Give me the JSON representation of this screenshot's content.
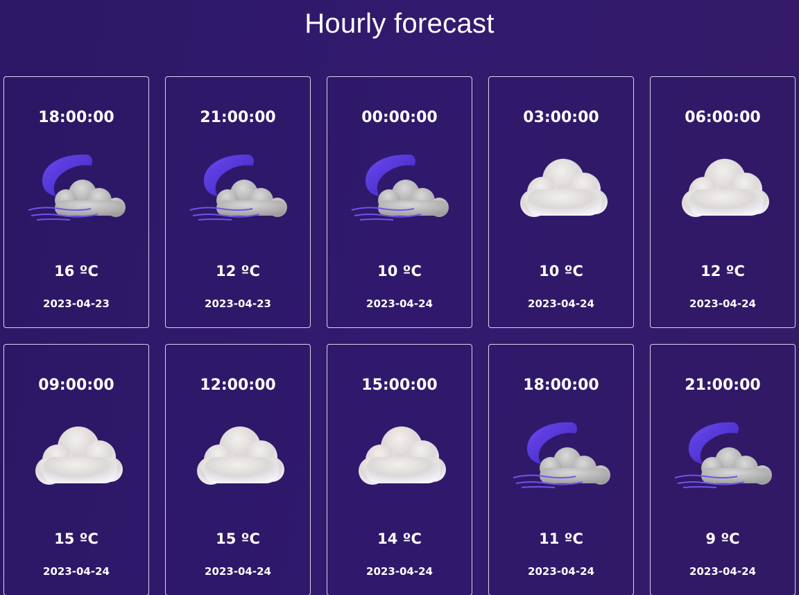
{
  "page": {
    "title": "Hourly forecast"
  },
  "colors": {
    "background": "#2f1a6c",
    "card_border": "#d9d4ec",
    "moon": "#5b3be0",
    "cloud": "#ececf2"
  },
  "forecasts": [
    {
      "time": "18:00:00",
      "temp": "16 ºC",
      "date": "2023-04-23",
      "icon": "night-cloud-wind-icon"
    },
    {
      "time": "21:00:00",
      "temp": "12 ºC",
      "date": "2023-04-23",
      "icon": "night-cloud-wind-icon"
    },
    {
      "time": "00:00:00",
      "temp": "10 ºC",
      "date": "2023-04-24",
      "icon": "night-cloud-wind-icon"
    },
    {
      "time": "03:00:00",
      "temp": "10 ºC",
      "date": "2023-04-24",
      "icon": "cloud-icon"
    },
    {
      "time": "06:00:00",
      "temp": "12 ºC",
      "date": "2023-04-24",
      "icon": "cloud-icon"
    },
    {
      "time": "09:00:00",
      "temp": "15 ºC",
      "date": "2023-04-24",
      "icon": "cloud-icon"
    },
    {
      "time": "12:00:00",
      "temp": "15 ºC",
      "date": "2023-04-24",
      "icon": "cloud-icon"
    },
    {
      "time": "15:00:00",
      "temp": "14 ºC",
      "date": "2023-04-24",
      "icon": "cloud-icon"
    },
    {
      "time": "18:00:00",
      "temp": "11 ºC",
      "date": "2023-04-24",
      "icon": "night-cloud-wind-icon"
    },
    {
      "time": "21:00:00",
      "temp": "9 ºC",
      "date": "2023-04-24",
      "icon": "night-cloud-wind-icon"
    }
  ]
}
